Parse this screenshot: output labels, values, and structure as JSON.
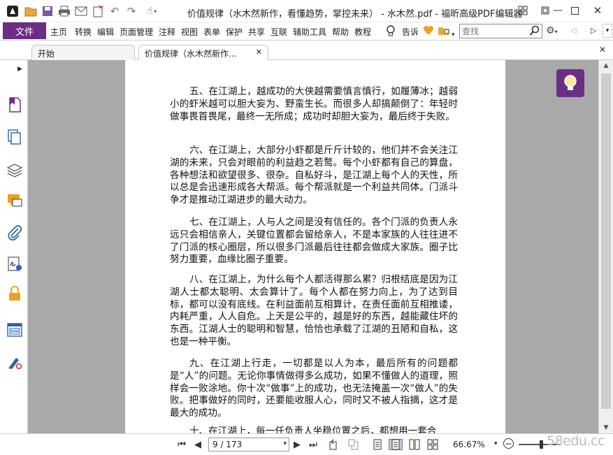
{
  "window": {
    "title": "价值规律（水木然新作，看懂趋势，掌控未来） - 水木然.pdf - 福昕高级PDF编辑器"
  },
  "menu": {
    "file": "文件",
    "items": [
      "主页",
      "转换",
      "编辑",
      "页面管理",
      "注释",
      "视图",
      "表单",
      "保护",
      "共享",
      "互联",
      "辅助工具",
      "帮助",
      "教程"
    ],
    "tell_me": "告诉",
    "search_placeholder": "查找"
  },
  "tabs": [
    {
      "label": "开始"
    },
    {
      "label": "价值规律（水木然新作..."
    }
  ],
  "document": {
    "paragraphs": [
      "五、在江湖上，越成功的大侠越需要慎言慎行，如履薄冰；越弱小的虾米越可以胆大妄为、野蛮生长。而很多人却搞颠倒了：年轻时做事畏首畏尾，最终一无所成；成功时却胆大妄为，最后终于失败。",
      "六、在江湖上，大部分小虾都是斤斤计较的，他们并不会关注江湖的未来，只会对眼前的利益趋之若鹜。每个小虾都有自己的算盘，各种想法和欲望很多、很杂。自私好斗，是江湖上每个人的天性，所以总是会迅速形成各大帮派。每个帮派就是一个利益共同体。门派斗争才是推动江湖进步的最大动力。",
      "七、在江湖上，人与人之间是没有信任的。各个门派的负责人永远只会相信亲人，关键位置都会留给亲人，不是本家族的人往往进不了门派的核心圈层，所以很多门派最后往往都会做成大家族。圈子比努力重要，血缘比圈子重要。",
      "八、在江湖上，为什么每个人都活得那么累？归根结底是因为江湖人士都太聪明、太会算计了。每个人都在努力向上，为了达到目标，都可以没有底线。在利益面前互相算计，在责任面前互相推诿，内耗严重，人人自危。上天是公平的，越是好的东西，越能藏住坏的东西。江湖人士的聪明和智慧，恰恰也承载了江湖的丑陋和自私，这也是一种平衡。",
      "九、在江湖上行走，一切都是以人为本，最后所有的问题都是“人”的问题。无论你事情做得多么成功，如果不懂做人的道理，照样会一败涂地。你十次“做事”上的成功，也无法掩盖一次“做人”的失败。把事做好的同时，还要能收服人心，同时又不被人指摘，这才是最大的成功。",
      "十、在江湖上，每一任负责人坐稳位置之后，都想用一套合"
    ]
  },
  "status": {
    "page_indicator": "9 / 173",
    "zoom": "66.67%"
  },
  "watermark": "58edu.cc",
  "colors": {
    "accent": "#6b2e84",
    "doc_background": "#a9a9a9",
    "page": "#ffffff"
  },
  "icons": [
    "app-logo-icon",
    "open-icon",
    "save-icon",
    "print-icon",
    "email-icon",
    "new-icon",
    "undo-icon",
    "redo-icon",
    "hand-tool-icon",
    "lightbulb-icon",
    "heart-icon",
    "folder-search-icon",
    "search-icon",
    "settings-icon",
    "prev-icon",
    "next-icon",
    "bookmark-icon",
    "pages-icon",
    "layers-icon",
    "comments-icon",
    "attachments-icon",
    "signature-icon",
    "security-icon",
    "form-fields-icon",
    "certify-icon"
  ]
}
